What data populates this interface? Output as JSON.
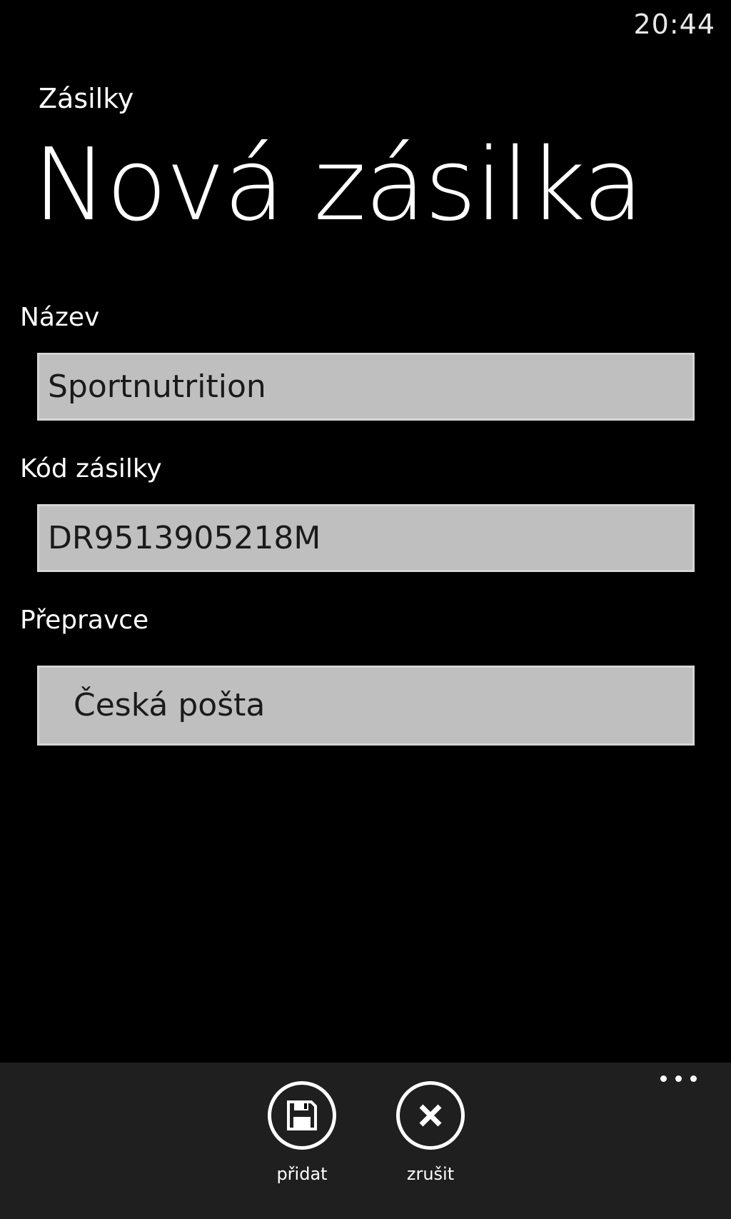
{
  "status_bar": {
    "time": "20:44"
  },
  "header": {
    "app_title": "Zásilky",
    "page_title": "Nová zásilka"
  },
  "form": {
    "name": {
      "label": "Název",
      "value": "Sportnutrition"
    },
    "code": {
      "label": "Kód zásilky",
      "value": "DR9513905218M"
    },
    "carrier": {
      "label": "Přepravce",
      "value": "Česká pošta"
    }
  },
  "app_bar": {
    "buttons": [
      {
        "label": "přidat",
        "icon": "save-icon"
      },
      {
        "label": "zrušit",
        "icon": "close-icon"
      }
    ],
    "more_icon": "ellipsis-icon"
  }
}
